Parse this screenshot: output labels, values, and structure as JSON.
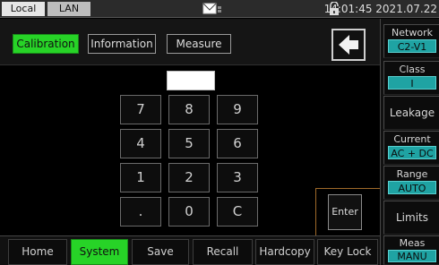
{
  "statusbar": {
    "tabs": [
      "Local",
      "LAN"
    ],
    "datetime": "14:01:45 2021.07.22",
    "icons": [
      "mail-icon",
      "lock-icon"
    ]
  },
  "subtabs": [
    "Calibration",
    "Information",
    "Measure"
  ],
  "active_subtab": "Calibration",
  "display_value": "",
  "keypad": {
    "rows": [
      [
        "7",
        "8",
        "9"
      ],
      [
        "4",
        "5",
        "6"
      ],
      [
        "1",
        "2",
        "3"
      ],
      [
        ".",
        "0",
        "C"
      ]
    ],
    "enter_label": "Enter"
  },
  "side": {
    "network": {
      "title": "Network",
      "value": "C2-V1"
    },
    "class": {
      "title": "Class",
      "value": "I"
    },
    "leakage": {
      "title": "Leakage"
    },
    "current": {
      "title": "Current",
      "value": "AC + DC"
    },
    "range": {
      "title": "Range",
      "value": "AUTO"
    },
    "limits": {
      "title": "Limits"
    },
    "meas": {
      "title": "Meas",
      "value": "MANU"
    }
  },
  "bottom": [
    "Home",
    "System",
    "Save",
    "Recall",
    "Hardcopy",
    "Key Lock"
  ],
  "active_bottom": "System",
  "colors": {
    "active": "#27d327",
    "value_bg": "#1fa3a3",
    "enter_frame": "#a06a2a"
  }
}
